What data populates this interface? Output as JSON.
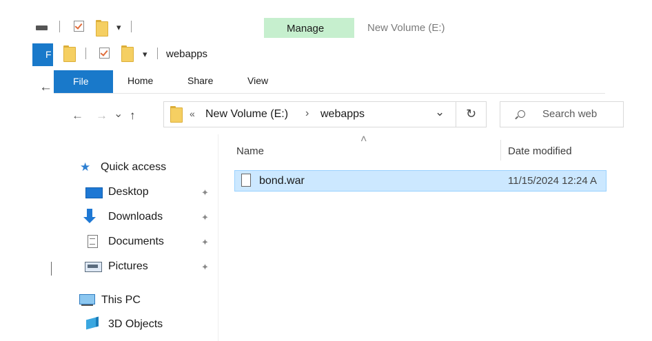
{
  "title_bar": {
    "context_tab": "Manage",
    "window_title": "New Volume (E:)",
    "accent_color": "#c6efce"
  },
  "inner_window": {
    "title": "webapps",
    "file_letter": "F"
  },
  "ribbon": {
    "tabs": [
      "File",
      "Home",
      "Share",
      "View"
    ],
    "file_tab_color": "#1979ca"
  },
  "address_bar": {
    "overflow": "«",
    "crumbs": [
      "New Volume (E:)",
      "webapps"
    ],
    "separator": "›",
    "search_placeholder": "Search web"
  },
  "file_list": {
    "columns": [
      "Name",
      "Date modified"
    ],
    "rows": [
      {
        "name": "bond.war",
        "date_modified": "11/15/2024 12:24 A",
        "selected": true
      }
    ]
  },
  "sidebar": {
    "quick_access": "Quick access",
    "items": [
      {
        "label": "Desktop",
        "icon": "desktop-icon",
        "pinned": true
      },
      {
        "label": "Downloads",
        "icon": "downloads-icon",
        "pinned": true
      },
      {
        "label": "Documents",
        "icon": "documents-icon",
        "pinned": true
      },
      {
        "label": "Pictures",
        "icon": "pictures-icon",
        "pinned": true
      }
    ],
    "this_pc": "This PC",
    "pc_items": [
      {
        "label": "3D Objects",
        "icon": "3d-objects-icon"
      }
    ]
  },
  "icons": {
    "pin": "✦",
    "back": "←",
    "forward": "→",
    "up": "↑",
    "recent_dropdown": "⌄",
    "address_dropdown": "⌄",
    "refresh": "↻",
    "sort_up": "˄",
    "qat_dropdown": "▾"
  }
}
